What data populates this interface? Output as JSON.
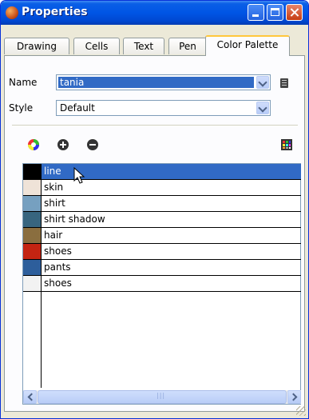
{
  "window": {
    "title": "Properties"
  },
  "tabs": [
    {
      "label": "Drawing",
      "active": false
    },
    {
      "label": "Cells",
      "active": false
    },
    {
      "label": "Text",
      "active": false
    },
    {
      "label": "Pen",
      "active": false
    },
    {
      "label": "Color Palette",
      "active": true
    }
  ],
  "form": {
    "name_label": "Name",
    "name_value": "tania",
    "style_label": "Style",
    "style_value": "Default"
  },
  "toolbar": {
    "icons": [
      "color-wheel-icon",
      "add-icon",
      "remove-icon",
      "palette-grid-icon"
    ]
  },
  "palette": {
    "rows": [
      {
        "label": "line",
        "color": "#000000",
        "selected": true
      },
      {
        "label": "skin",
        "color": "#efe3d8",
        "selected": false
      },
      {
        "label": "shirt",
        "color": "#76a0c0",
        "selected": false
      },
      {
        "label": "shirt shadow",
        "color": "#37657f",
        "selected": false
      },
      {
        "label": "hair",
        "color": "#8a6e3f",
        "selected": false
      },
      {
        "label": "shoes",
        "color": "#c42412",
        "selected": false
      },
      {
        "label": "pants",
        "color": "#2d5e9b",
        "selected": false
      },
      {
        "label": "shoes",
        "color": "#f2f2f2",
        "selected": false
      }
    ],
    "selected_row_color": "#316ac5"
  },
  "colors": {
    "accent": "#316ac5",
    "titlebar": "#0055e5",
    "tab_highlight": "#ffc73c"
  }
}
